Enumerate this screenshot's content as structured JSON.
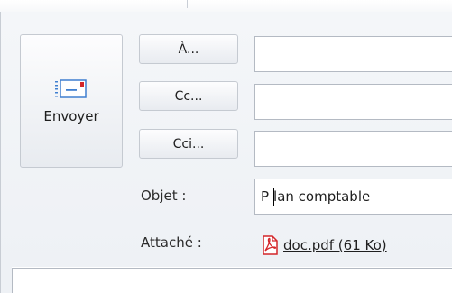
{
  "compose": {
    "send_label": "Envoyer",
    "to_button": "À...",
    "cc_button": "Cc...",
    "bcc_button": "Cci...",
    "to_value": "",
    "cc_value": "",
    "bcc_value": "",
    "subject_label": "Objet :",
    "subject_value_before_caret": "P",
    "subject_value_after_caret": "lan comptable",
    "attached_label": "Attaché :",
    "attachment_name": "doc.pdf (61 Ko)"
  },
  "colors": {
    "panel_bg": "#eef1f5",
    "field_border": "#b4bac3",
    "pdf_red": "#d4262a",
    "send_icon_blue": "#3f7fd0"
  },
  "icons": {
    "send": "send-mail-icon",
    "attachment": "pdf-file-icon"
  }
}
